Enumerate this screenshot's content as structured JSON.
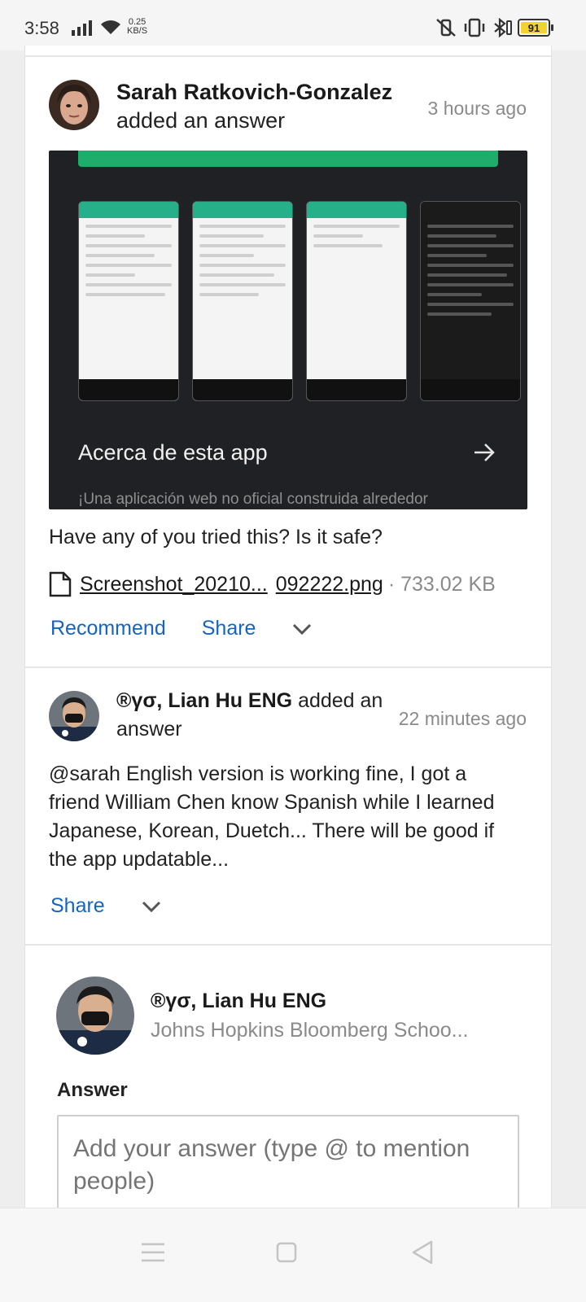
{
  "status_bar": {
    "time": "3:58",
    "speed_value": "0.25",
    "speed_unit": "KB/S",
    "battery": "91"
  },
  "posts": [
    {
      "author": "Sarah Ratkovich-Gonzalez",
      "action": "added an answer",
      "time": "3 hours ago",
      "preview": {
        "title": "Acerca de esta app",
        "subtitle": "¡Una aplicación web no oficial construida alrededor"
      },
      "text": "Have any of you tried this? Is it safe?",
      "attachment": {
        "name_start": "Screenshot_20210...",
        "name_end": "092222.png",
        "size": "· 733.02 KB"
      },
      "actions": {
        "recommend": "Recommend",
        "share": "Share"
      }
    },
    {
      "author": "®γσ, Lian Hu ENG",
      "action": "added an answer",
      "time": "22 minutes ago",
      "text": "@sarah English version is working fine, I got a friend William Chen know Spanish while I learned Japanese, Korean, Duetch... There will be good if the app updatable...",
      "actions": {
        "share": "Share"
      }
    }
  ],
  "composer": {
    "name": "®γσ, Lian Hu ENG",
    "institution": "Johns Hopkins Bloomberg Schoo...",
    "label": "Answer",
    "placeholder": "Add your answer (type @ to mention people)"
  },
  "colors": {
    "link": "#1565c0",
    "accent_green": "#1fad6b",
    "battery": "#f2d130"
  }
}
